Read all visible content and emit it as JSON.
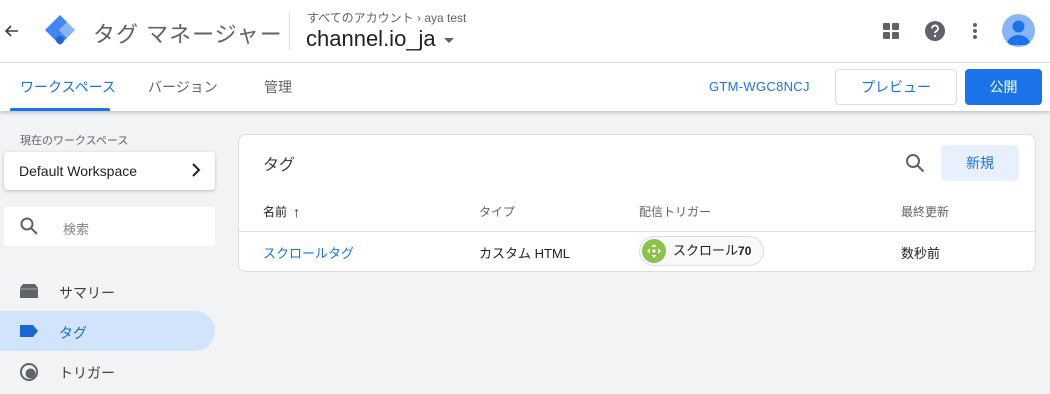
{
  "header": {
    "product_name": "タグ マネージャー",
    "breadcrumb": "すべてのアカウント  ›  aya test",
    "container_name": "channel.io_ja",
    "icons": [
      "back-arrow-icon",
      "gtm-logo",
      "apps-grid-icon",
      "help-icon",
      "more-vert-icon",
      "account-avatar"
    ]
  },
  "tabs": [
    {
      "label": "ワークスペース",
      "active": true
    },
    {
      "label": "バージョン",
      "active": false
    },
    {
      "label": "管理",
      "active": false
    }
  ],
  "toolbar": {
    "container_id": "GTM-WGC8NCJ",
    "preview_label": "プレビュー",
    "publish_label": "公開"
  },
  "sidebar": {
    "workspace_label": "現在のワークスペース",
    "workspace_name": "Default Workspace",
    "search_placeholder": "検索",
    "items": [
      {
        "label": "サマリー",
        "icon": "summary-icon",
        "active": false
      },
      {
        "label": "タグ",
        "icon": "tag-icon",
        "active": true
      },
      {
        "label": "トリガー",
        "icon": "trigger-icon",
        "active": false
      }
    ]
  },
  "main": {
    "title": "タグ",
    "new_button": "新規",
    "columns": [
      "名前",
      "タイプ",
      "配信トリガー",
      "最終更新"
    ],
    "sort_indicator": "↑",
    "rows": [
      {
        "name": "スクロールタグ",
        "type": "カスタム HTML",
        "trigger_name": "スクロール",
        "trigger_suffix": "70",
        "updated": "数秒前"
      }
    ]
  },
  "colors": {
    "accent": "#1a73e8",
    "active_nav_bg": "#d2e3fc",
    "trigger_icon_green": "#8bc34a"
  }
}
